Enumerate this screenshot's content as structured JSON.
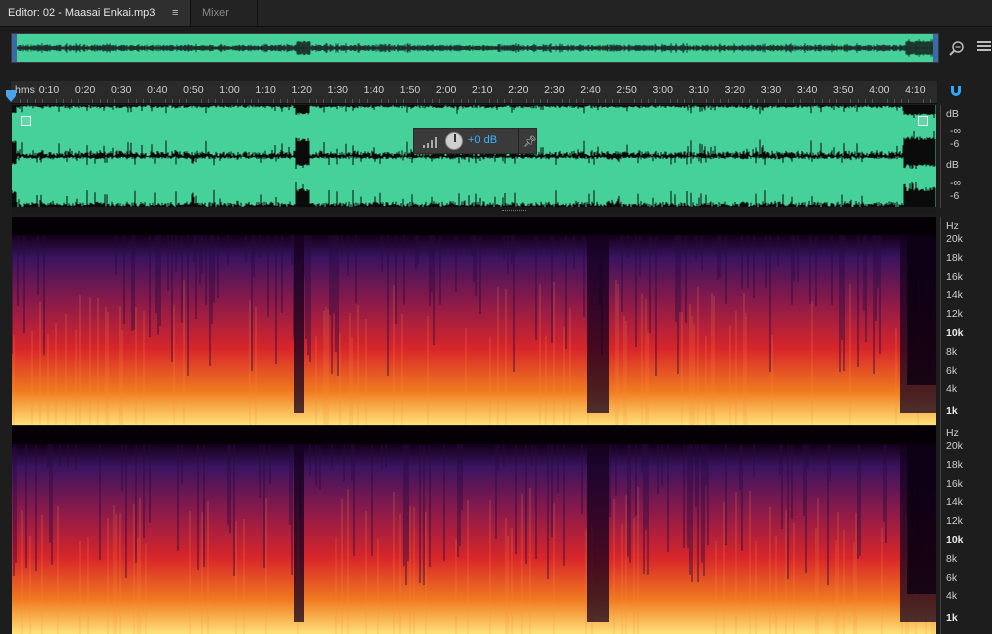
{
  "tabs": [
    {
      "label": "Editor: 02 - Maasai Enkai.mp3",
      "active": true
    },
    {
      "label": "Mixer",
      "active": false
    }
  ],
  "tab_menu_glyph": "≡",
  "ruler": {
    "units_label": "hms",
    "labels": [
      "0:10",
      "0:20",
      "0:30",
      "0:40",
      "0:50",
      "1:00",
      "1:10",
      "1:20",
      "1:30",
      "1:40",
      "1:50",
      "2:00",
      "2:10",
      "2:20",
      "2:30",
      "2:40",
      "2:50",
      "3:00",
      "3:10",
      "3:20",
      "3:30",
      "3:40",
      "3:50",
      "4:00",
      "4:10"
    ]
  },
  "hud": {
    "gain_value": "+0 dB"
  },
  "channel_scale": {
    "top": {
      "unit": "dB",
      "marks": [
        "-∞",
        "-6"
      ]
    },
    "bottom": {
      "unit": "dB",
      "marks": [
        "-∞",
        "-6"
      ]
    }
  },
  "freq_scale": {
    "unit": "Hz",
    "labels": [
      "20k",
      "18k",
      "16k",
      "14k",
      "12k",
      "10k",
      "8k",
      "6k",
      "4k",
      "1k"
    ]
  },
  "icons": {
    "zoom": "zoom-magnifier-icon",
    "panel_menu": "panel-menu-icon",
    "snap": "snap-magnet-icon",
    "playhead": "playhead-marker-icon",
    "pin": "pin-icon"
  },
  "colors": {
    "waveform": "#46d19a",
    "accent": "#3fb4ff",
    "spectral_hot": "#ffe27a",
    "spectral_mid": "#d8262a",
    "spectral_cool": "#4a1770"
  }
}
